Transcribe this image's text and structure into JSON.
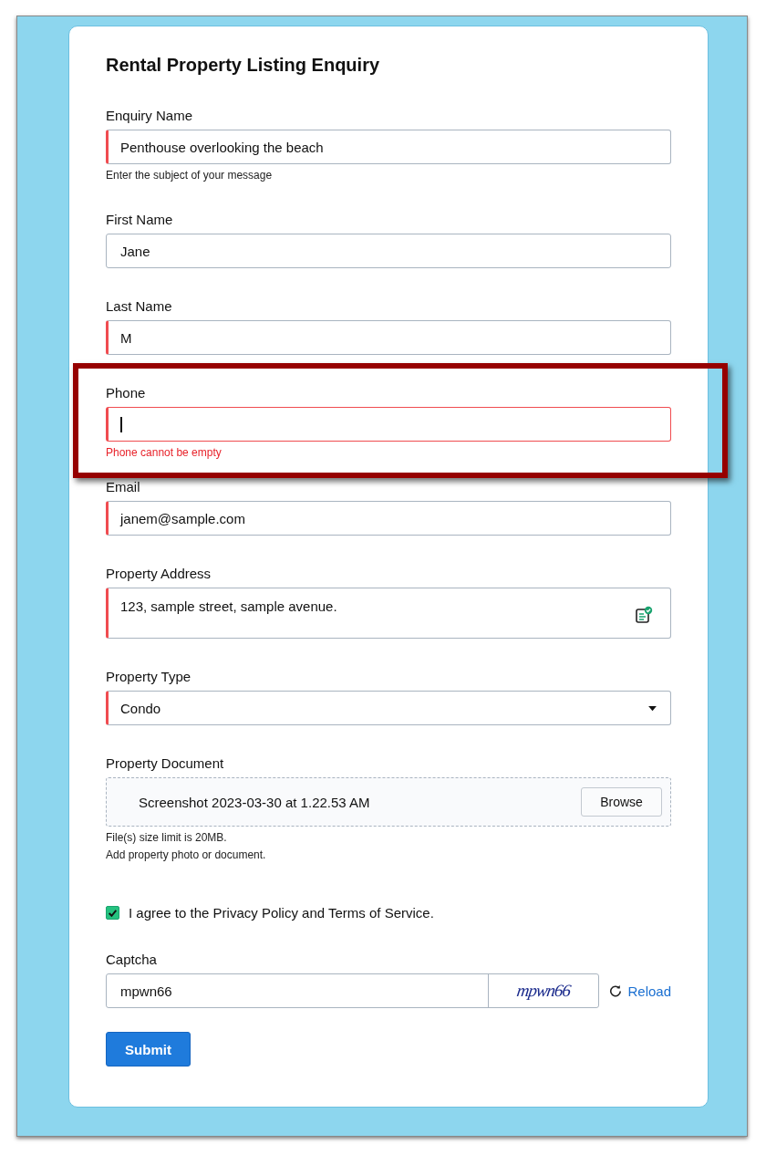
{
  "form": {
    "title": "Rental Property Listing Enquiry",
    "fields": [
      {
        "kind": "text",
        "label": "Enquiry Name",
        "value": "Penthouse overlooking the beach",
        "required": true,
        "help": [
          "Enter the subject of your message"
        ]
      },
      {
        "kind": "text",
        "label": "First Name",
        "value": "Jane",
        "required": false
      },
      {
        "kind": "text",
        "label": "Last Name",
        "value": "M",
        "required": true
      },
      {
        "kind": "text",
        "label": "Phone",
        "required": true,
        "focused": true,
        "error": "Phone cannot be empty",
        "highlighted": true
      },
      {
        "kind": "text",
        "label": "Email",
        "value": "janem@sample.com",
        "required": true
      },
      {
        "kind": "textarea",
        "label": "Property Address",
        "value": "123, sample street, sample avenue.",
        "required": true
      },
      {
        "kind": "select",
        "label": "Property Type",
        "value": "Condo",
        "required": true
      },
      {
        "kind": "file",
        "label": "Property Document",
        "value": "Screenshot 2023-03-30 at 1.22.53 AM",
        "button": "Browse",
        "required": false,
        "help": [
          "File(s) size limit is 20MB.",
          "Add property photo or document."
        ]
      }
    ],
    "agree": {
      "label": "I agree to the Privacy Policy and Terms of Service.",
      "checked": true
    },
    "captcha": {
      "label": "Captcha",
      "value": "mpwn66",
      "image_text": "mpwn66",
      "reload": "Reload"
    },
    "submit": "Submit"
  }
}
